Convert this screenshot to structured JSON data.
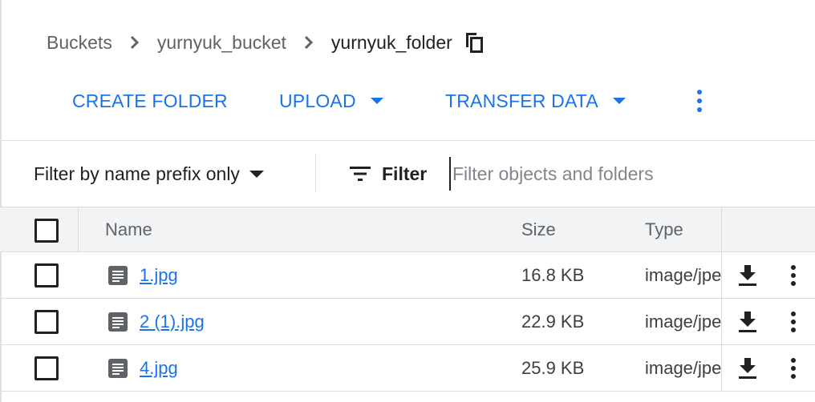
{
  "breadcrumb": {
    "items": [
      "Buckets",
      "yurnyuk_bucket"
    ],
    "current": "yurnyuk_folder",
    "separator": "›"
  },
  "actions": {
    "create_folder": "CREATE FOLDER",
    "upload": "UPLOAD",
    "transfer_data": "TRANSFER DATA"
  },
  "filter_bar": {
    "prefix_select": "Filter by name prefix only",
    "filter_label": "Filter",
    "placeholder": "Filter objects and folders"
  },
  "table": {
    "columns": {
      "name": "Name",
      "size": "Size",
      "type": "Type"
    },
    "rows": [
      {
        "name": "1.jpg",
        "size": "16.8 KB",
        "type": "image/jpeg"
      },
      {
        "name": "2 (1).jpg",
        "size": "22.9 KB",
        "type": "image/jpeg"
      },
      {
        "name": "4.jpg",
        "size": "25.9 KB",
        "type": "image/jpeg"
      }
    ]
  },
  "colors": {
    "accent": "#1a73e8",
    "header_bg": "#f1f3f4",
    "border": "#dadce0"
  },
  "icons": [
    "chevron-right-icon",
    "copy-icon",
    "dropdown-caret-icon",
    "more-vert-icon",
    "filter-list-icon",
    "file-icon",
    "download-icon"
  ]
}
